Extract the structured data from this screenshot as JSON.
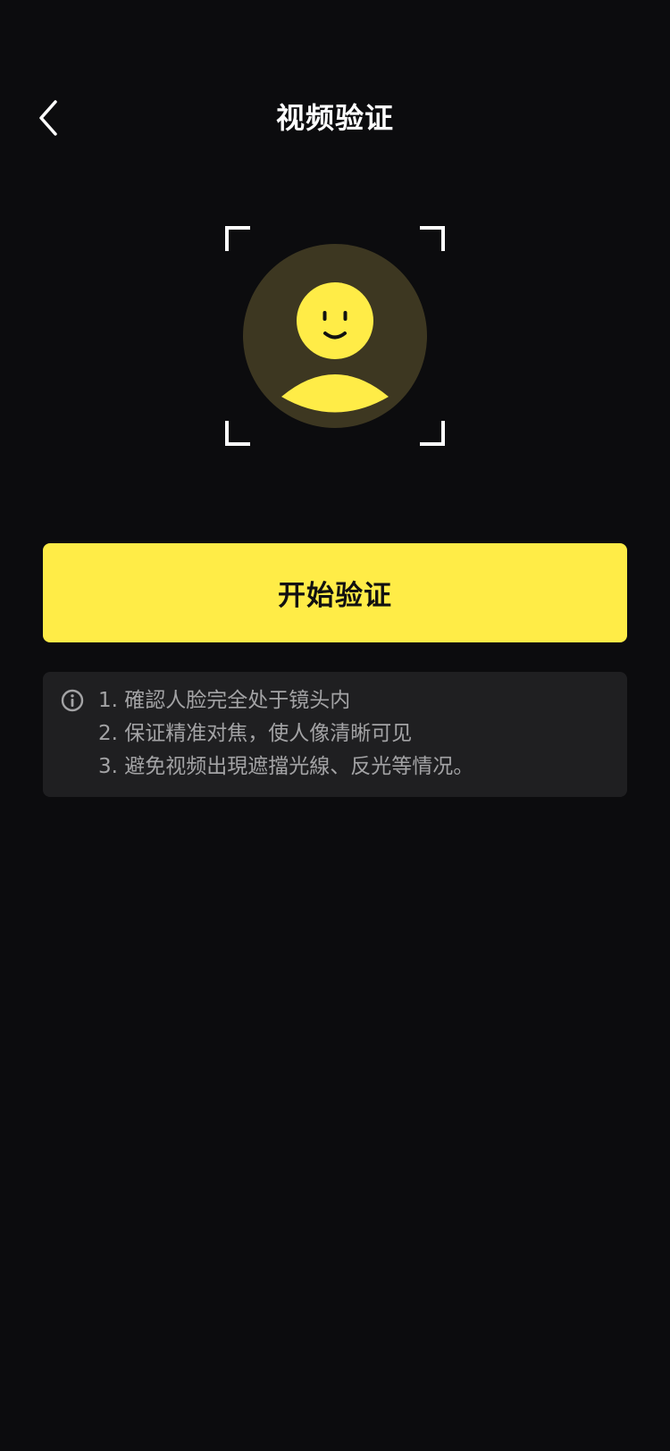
{
  "header": {
    "title": "视频验证",
    "back_icon": "chevron-left-icon"
  },
  "illustration": {
    "icon": "face-scan-icon",
    "accent_color": "#ffec47",
    "circle_color": "#3d3721"
  },
  "primary_action": {
    "label": "开始验证",
    "background": "#ffec47"
  },
  "tips": {
    "icon": "info-icon",
    "items": [
      "1. 確認人脸完全处于镜头内",
      "2. 保证精准对焦，使人像清晰可见",
      "3. 避免视频出現遮擋光線、反光等情况。"
    ]
  },
  "colors": {
    "background": "#0c0c0e",
    "card": "#1f1f21",
    "tip_text": "#a3a3a5"
  }
}
